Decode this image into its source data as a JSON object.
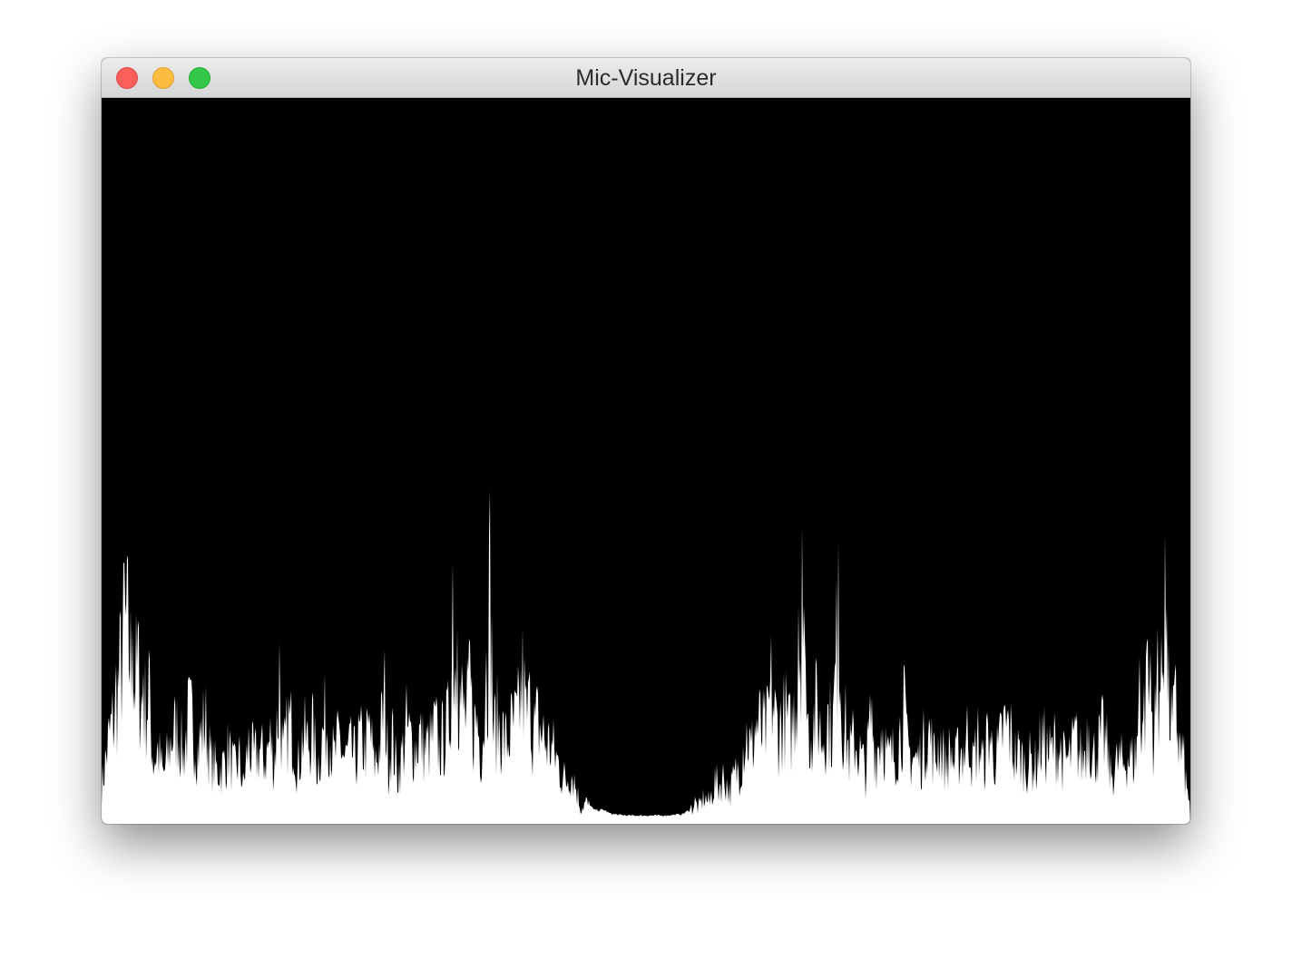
{
  "window": {
    "title": "Mic-Visualizer",
    "controls": {
      "close": {
        "color": "#fc605c",
        "icon": "close-icon"
      },
      "minimize": {
        "color": "#fdbc40",
        "icon": "minimize-icon"
      },
      "zoom": {
        "color": "#34c84a",
        "icon": "zoom-icon"
      }
    }
  },
  "visualizer": {
    "background_color": "#000000",
    "bar_color": "#ffffff",
    "chart_data": {
      "type": "bar",
      "title": "",
      "xlabel": "",
      "ylabel": "",
      "ylim": [
        0,
        1
      ],
      "grid": false,
      "legend": "none",
      "peaks": [
        [
          0,
          0.07
        ],
        [
          8,
          0.16
        ],
        [
          16,
          0.22
        ],
        [
          25,
          0.36
        ],
        [
          28,
          0.37
        ],
        [
          34,
          0.27
        ],
        [
          40,
          0.28
        ],
        [
          46,
          0.21
        ],
        [
          52,
          0.24
        ],
        [
          57,
          0.12
        ],
        [
          62,
          0.14
        ],
        [
          68,
          0.09
        ],
        [
          72,
          0.12
        ],
        [
          78,
          0.17
        ],
        [
          84,
          0.18
        ],
        [
          90,
          0.13
        ],
        [
          96,
          0.2
        ],
        [
          100,
          0.19
        ],
        [
          106,
          0.14
        ],
        [
          114,
          0.2
        ],
        [
          120,
          0.12
        ],
        [
          128,
          0.1
        ],
        [
          134,
          0.11
        ],
        [
          140,
          0.14
        ],
        [
          146,
          0.1
        ],
        [
          152,
          0.12
        ],
        [
          156,
          0.07
        ],
        [
          162,
          0.15
        ],
        [
          168,
          0.12
        ],
        [
          174,
          0.14
        ],
        [
          180,
          0.12
        ],
        [
          186,
          0.16
        ],
        [
          190,
          0.11
        ],
        [
          196,
          0.25
        ],
        [
          200,
          0.12
        ],
        [
          206,
          0.19
        ],
        [
          212,
          0.17
        ],
        [
          216,
          0.1
        ],
        [
          222,
          0.17
        ],
        [
          228,
          0.15
        ],
        [
          232,
          0.18
        ],
        [
          238,
          0.11
        ],
        [
          246,
          0.19
        ],
        [
          250,
          0.19
        ],
        [
          256,
          0.12
        ],
        [
          262,
          0.16
        ],
        [
          268,
          0.12
        ],
        [
          274,
          0.14
        ],
        [
          280,
          0.12
        ],
        [
          284,
          0.16
        ],
        [
          290,
          0.14
        ],
        [
          296,
          0.18
        ],
        [
          300,
          0.11
        ],
        [
          306,
          0.14
        ],
        [
          312,
          0.24
        ],
        [
          316,
          0.11
        ],
        [
          320,
          0.17
        ],
        [
          326,
          0.09
        ],
        [
          330,
          0.12
        ],
        [
          336,
          0.18
        ],
        [
          340,
          0.16
        ],
        [
          346,
          0.14
        ],
        [
          350,
          0.17
        ],
        [
          356,
          0.14
        ],
        [
          362,
          0.15
        ],
        [
          368,
          0.18
        ],
        [
          372,
          0.14
        ],
        [
          378,
          0.17
        ],
        [
          383,
          0.19
        ],
        [
          387,
          0.36
        ],
        [
          392,
          0.27
        ],
        [
          397,
          0.22
        ],
        [
          402,
          0.2
        ],
        [
          406,
          0.25
        ],
        [
          410,
          0.18
        ],
        [
          414,
          0.2
        ],
        [
          418,
          0.14
        ],
        [
          424,
          0.24
        ],
        [
          428,
          0.46
        ],
        [
          432,
          0.17
        ],
        [
          436,
          0.19
        ],
        [
          440,
          0.18
        ],
        [
          446,
          0.15
        ],
        [
          452,
          0.18
        ],
        [
          458,
          0.19
        ],
        [
          464,
          0.27
        ],
        [
          468,
          0.2
        ],
        [
          472,
          0.21
        ],
        [
          476,
          0.17
        ],
        [
          480,
          0.19
        ],
        [
          486,
          0.17
        ],
        [
          490,
          0.15
        ],
        [
          494,
          0.15
        ],
        [
          500,
          0.13
        ],
        [
          504,
          0.11
        ],
        [
          508,
          0.09
        ],
        [
          512,
          0.08
        ],
        [
          516,
          0.1
        ],
        [
          520,
          0.09
        ],
        [
          524,
          0.06
        ],
        [
          528,
          0.03
        ],
        [
          534,
          0.04
        ],
        [
          538,
          0.03
        ],
        [
          542,
          0.02
        ],
        [
          548,
          0.02
        ],
        [
          554,
          0.02
        ],
        [
          560,
          0.015
        ],
        [
          570,
          0.013
        ],
        [
          580,
          0.012
        ],
        [
          590,
          0.012
        ],
        [
          600,
          0.012
        ],
        [
          610,
          0.012
        ],
        [
          620,
          0.012
        ],
        [
          630,
          0.013
        ],
        [
          640,
          0.014
        ],
        [
          648,
          0.02
        ],
        [
          654,
          0.04
        ],
        [
          658,
          0.03
        ],
        [
          664,
          0.05
        ],
        [
          670,
          0.04
        ],
        [
          676,
          0.08
        ],
        [
          680,
          0.07
        ],
        [
          686,
          0.09
        ],
        [
          692,
          0.06
        ],
        [
          698,
          0.09
        ],
        [
          704,
          0.11
        ],
        [
          708,
          0.16
        ],
        [
          712,
          0.17
        ],
        [
          716,
          0.13
        ],
        [
          720,
          0.18
        ],
        [
          724,
          0.19
        ],
        [
          728,
          0.17
        ],
        [
          734,
          0.18
        ],
        [
          738,
          0.26
        ],
        [
          742,
          0.2
        ],
        [
          746,
          0.18
        ],
        [
          750,
          0.19
        ],
        [
          754,
          0.21
        ],
        [
          758,
          0.17
        ],
        [
          762,
          0.19
        ],
        [
          768,
          0.3
        ],
        [
          772,
          0.41
        ],
        [
          776,
          0.22
        ],
        [
          780,
          0.17
        ],
        [
          784,
          0.19
        ],
        [
          788,
          0.22
        ],
        [
          794,
          0.16
        ],
        [
          800,
          0.2
        ],
        [
          806,
          0.18
        ],
        [
          812,
          0.39
        ],
        [
          816,
          0.2
        ],
        [
          820,
          0.18
        ],
        [
          824,
          0.13
        ],
        [
          830,
          0.16
        ],
        [
          836,
          0.13
        ],
        [
          842,
          0.1
        ],
        [
          848,
          0.2
        ],
        [
          854,
          0.13
        ],
        [
          860,
          0.19
        ],
        [
          866,
          0.12
        ],
        [
          872,
          0.13
        ],
        [
          878,
          0.15
        ],
        [
          884,
          0.22
        ],
        [
          888,
          0.14
        ],
        [
          892,
          0.13
        ],
        [
          898,
          0.12
        ],
        [
          904,
          0.13
        ],
        [
          910,
          0.18
        ],
        [
          914,
          0.16
        ],
        [
          918,
          0.12
        ],
        [
          924,
          0.16
        ],
        [
          930,
          0.11
        ],
        [
          936,
          0.14
        ],
        [
          940,
          0.11
        ],
        [
          946,
          0.14
        ],
        [
          950,
          0.14
        ],
        [
          956,
          0.18
        ],
        [
          960,
          0.11
        ],
        [
          966,
          0.16
        ],
        [
          972,
          0.11
        ],
        [
          978,
          0.18
        ],
        [
          982,
          0.13
        ],
        [
          988,
          0.13
        ],
        [
          994,
          0.18
        ],
        [
          1000,
          0.18
        ],
        [
          1006,
          0.13
        ],
        [
          1012,
          0.13
        ],
        [
          1018,
          0.11
        ],
        [
          1024,
          0.12
        ],
        [
          1030,
          0.11
        ],
        [
          1036,
          0.16
        ],
        [
          1042,
          0.14
        ],
        [
          1046,
          0.13
        ],
        [
          1050,
          0.15
        ],
        [
          1056,
          0.14
        ],
        [
          1060,
          0.12
        ],
        [
          1066,
          0.12
        ],
        [
          1070,
          0.14
        ],
        [
          1074,
          0.16
        ],
        [
          1078,
          0.13
        ],
        [
          1082,
          0.12
        ],
        [
          1088,
          0.2
        ],
        [
          1092,
          0.12
        ],
        [
          1096,
          0.14
        ],
        [
          1100,
          0.15
        ],
        [
          1104,
          0.17
        ],
        [
          1108,
          0.14
        ],
        [
          1112,
          0.09
        ],
        [
          1118,
          0.11
        ],
        [
          1122,
          0.12
        ],
        [
          1126,
          0.11
        ],
        [
          1130,
          0.13
        ],
        [
          1136,
          0.12
        ],
        [
          1140,
          0.13
        ],
        [
          1144,
          0.23
        ],
        [
          1148,
          0.2
        ],
        [
          1152,
          0.25
        ],
        [
          1156,
          0.24
        ],
        [
          1160,
          0.16
        ],
        [
          1164,
          0.27
        ],
        [
          1168,
          0.26
        ],
        [
          1172,
          0.4
        ],
        [
          1176,
          0.25
        ],
        [
          1180,
          0.17
        ],
        [
          1184,
          0.22
        ],
        [
          1188,
          0.14
        ],
        [
          1192,
          0.13
        ],
        [
          1196,
          0.06
        ],
        [
          1199,
          0.05
        ]
      ]
    }
  }
}
